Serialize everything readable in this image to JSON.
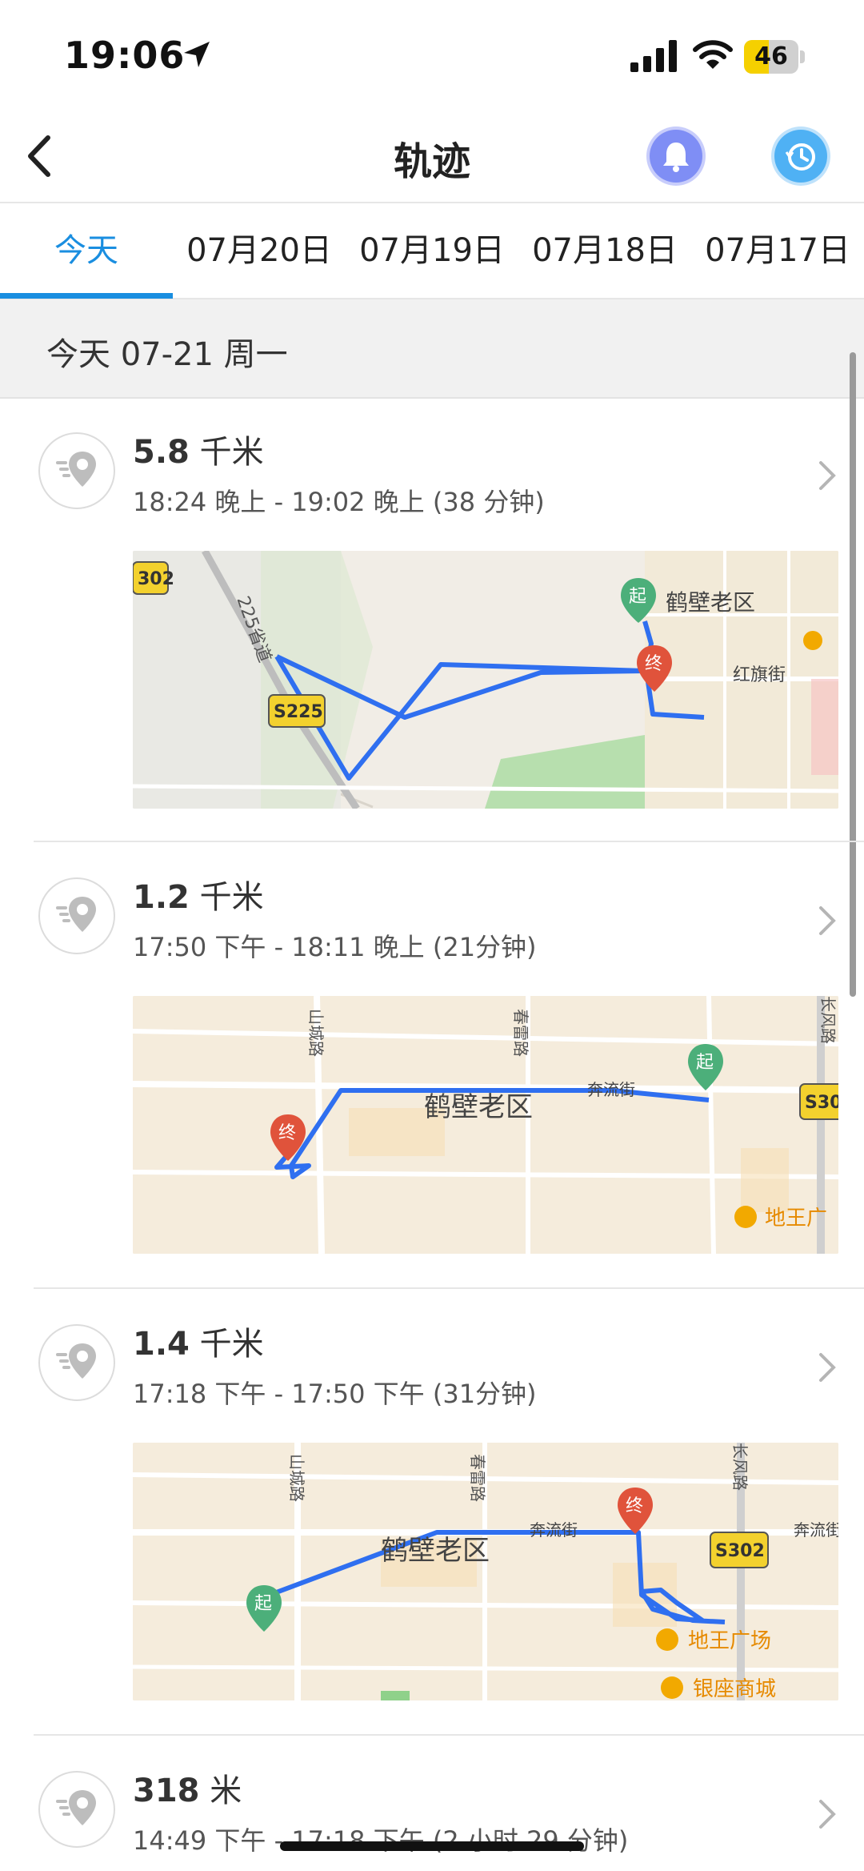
{
  "status_bar": {
    "time": "19:06",
    "battery_level": "46",
    "battery_fraction": 0.46
  },
  "header": {
    "title": "轨迹",
    "icons": [
      "back-icon",
      "bell-icon",
      "history-icon"
    ]
  },
  "tabs": [
    {
      "label": "今天",
      "active": true
    },
    {
      "label": "07月20日"
    },
    {
      "label": "07月19日"
    },
    {
      "label": "07月18日"
    },
    {
      "label": "07月17日"
    }
  ],
  "section": {
    "date_label": "今天 07-21 周一"
  },
  "trips": [
    {
      "distance_value": "5.8",
      "distance_unit": "千米",
      "time_range": "18:24 晚上 - 19:02 晚上 (38 分钟)",
      "map_labels": [
        "302",
        "225省道",
        "S225",
        "鹤壁老区",
        "红旗街",
        "起",
        "终"
      ]
    },
    {
      "distance_value": "1.2",
      "distance_unit": "千米",
      "time_range": "17:50 下午 - 18:11 晚上 (21分钟)",
      "map_labels": [
        "山城路",
        "春雷路",
        "鹤壁老区",
        "奔流街",
        "S30",
        "地王广",
        "长风路",
        "起",
        "终"
      ]
    },
    {
      "distance_value": "1.4",
      "distance_unit": "千米",
      "time_range": "17:18 下午 - 17:50 下午 (31分钟)",
      "map_labels": [
        "山城路",
        "春雷路",
        "鹤壁老区",
        "奔流街",
        "S302",
        "奔流街",
        "地王广场",
        "银座商城",
        "长风路",
        "起",
        "终"
      ]
    },
    {
      "distance_value": "318",
      "distance_unit": "米",
      "time_range": "14:49 下午 - 17:18 下午 (2 小时 29 分钟)"
    }
  ],
  "colors": {
    "accent": "#1a8ee0",
    "route": "#2f6ff0",
    "start_pin": "#4caf7a",
    "end_pin": "#e0533b",
    "road_sign": "#f3d12e"
  }
}
